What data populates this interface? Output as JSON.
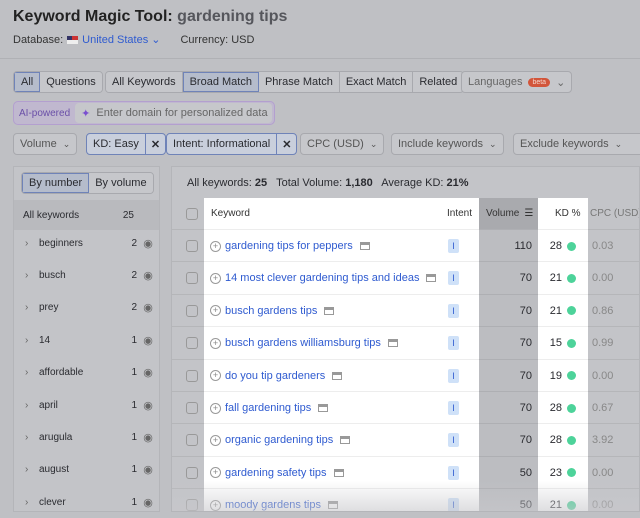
{
  "header": {
    "title": "Keyword Magic Tool:",
    "query": "gardening tips",
    "database_label": "Database:",
    "database_value": "United States",
    "currency": "Currency: USD"
  },
  "tabs1": [
    "All",
    "Questions"
  ],
  "tabs2": [
    "All Keywords",
    "Broad Match",
    "Phrase Match",
    "Exact Match",
    "Related"
  ],
  "languages": {
    "label": "Languages",
    "badge": "beta"
  },
  "ai": {
    "label": "AI-powered",
    "placeholder": "Enter domain for personalized data"
  },
  "filters": {
    "volume": "Volume",
    "kd": "KD: Easy",
    "intent": "Intent: Informational",
    "cpc": "CPC (USD)",
    "include": "Include keywords",
    "exclude": "Exclude keywords"
  },
  "sidebar": {
    "toggle": [
      "By number",
      "By volume"
    ],
    "all_label": "All keywords",
    "all_count": "25",
    "items": [
      {
        "label": "beginners",
        "count": "2"
      },
      {
        "label": "busch",
        "count": "2"
      },
      {
        "label": "prey",
        "count": "2"
      },
      {
        "label": "14",
        "count": "1"
      },
      {
        "label": "affordable",
        "count": "1"
      },
      {
        "label": "april",
        "count": "1"
      },
      {
        "label": "arugula",
        "count": "1"
      },
      {
        "label": "august",
        "count": "1"
      },
      {
        "label": "clever",
        "count": "1"
      }
    ]
  },
  "summary": {
    "all_label": "All keywords:",
    "all": "25",
    "vol_label": "Total Volume:",
    "vol": "1,180",
    "kd_label": "Average KD:",
    "kd": "21%"
  },
  "table": {
    "headers": {
      "keyword": "Keyword",
      "intent": "Intent",
      "volume": "Volume",
      "kd": "KD %",
      "cpc": "CPC (USD)"
    },
    "rows": [
      {
        "keyword": "gardening tips for peppers",
        "intent": "I",
        "volume": "110",
        "kd": "28",
        "cpc": "0.03"
      },
      {
        "keyword": "14 most clever gardening tips and ideas",
        "intent": "I",
        "volume": "70",
        "kd": "21",
        "cpc": "0.00"
      },
      {
        "keyword": "busch gardens tips",
        "intent": "I",
        "volume": "70",
        "kd": "21",
        "cpc": "0.86"
      },
      {
        "keyword": "busch gardens williamsburg tips",
        "intent": "I",
        "volume": "70",
        "kd": "15",
        "cpc": "0.99"
      },
      {
        "keyword": "do you tip gardeners",
        "intent": "I",
        "volume": "70",
        "kd": "19",
        "cpc": "0.00"
      },
      {
        "keyword": "fall gardening tips",
        "intent": "I",
        "volume": "70",
        "kd": "28",
        "cpc": "0.67"
      },
      {
        "keyword": "organic gardening tips",
        "intent": "I",
        "volume": "70",
        "kd": "28",
        "cpc": "3.92"
      },
      {
        "keyword": "gardening safety tips",
        "intent": "I",
        "volume": "50",
        "kd": "23",
        "cpc": "0.00"
      },
      {
        "keyword": "moody gardens tips",
        "intent": "I",
        "volume": "50",
        "kd": "21",
        "cpc": "0.00"
      }
    ]
  },
  "colors": {
    "link": "#2f5bd0",
    "kd_easy": "#4dd39a",
    "beta": "#d2553a"
  }
}
